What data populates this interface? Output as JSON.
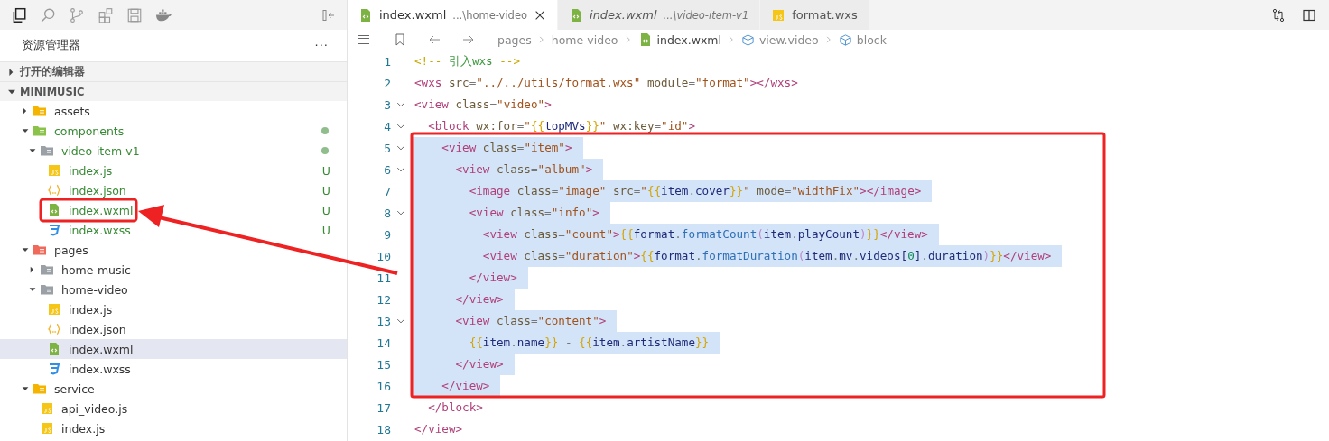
{
  "explorer": {
    "title": "资源管理器",
    "more": "···"
  },
  "sections": [
    {
      "label": "打开的编辑器",
      "expanded": false
    },
    {
      "label": "MINIMUSIC",
      "expanded": true
    }
  ],
  "tree": [
    {
      "label": "assets",
      "kind": "folder",
      "color": "#f4b400",
      "expanded": false,
      "untracked": false,
      "dot": false,
      "selected": false
    },
    {
      "label": "components",
      "kind": "folder",
      "color": "#8bc34a",
      "expanded": true,
      "untracked": true,
      "dot": true,
      "selected": false,
      "children": [
        {
          "label": "video-item-v1",
          "kind": "folder",
          "color": "#9aa0a6",
          "expanded": true,
          "untracked": true,
          "dot": true,
          "selected": false,
          "children": [
            {
              "label": "index.js",
              "kind": "js",
              "untracked": true,
              "dot": false,
              "badge": "U",
              "selected": false
            },
            {
              "label": "index.json",
              "kind": "json",
              "untracked": true,
              "dot": false,
              "badge": "U",
              "selected": false
            },
            {
              "label": "index.wxml",
              "kind": "wxml",
              "untracked": true,
              "dot": false,
              "badge": "U",
              "selected": false
            },
            {
              "label": "index.wxss",
              "kind": "wxss",
              "untracked": true,
              "dot": false,
              "badge": "U",
              "selected": false
            }
          ]
        }
      ]
    },
    {
      "label": "pages",
      "kind": "folder",
      "color": "#ef6a5a",
      "expanded": true,
      "untracked": false,
      "dot": false,
      "selected": false,
      "children": [
        {
          "label": "home-music",
          "kind": "folder",
          "color": "#9aa0a6",
          "expanded": false,
          "untracked": false,
          "dot": false,
          "selected": false
        },
        {
          "label": "home-video",
          "kind": "folder",
          "color": "#9aa0a6",
          "expanded": true,
          "untracked": false,
          "dot": false,
          "selected": false,
          "children": [
            {
              "label": "index.js",
              "kind": "js",
              "untracked": false,
              "dot": false,
              "selected": false
            },
            {
              "label": "index.json",
              "kind": "json",
              "untracked": false,
              "dot": false,
              "selected": false
            },
            {
              "label": "index.wxml",
              "kind": "wxml",
              "untracked": false,
              "dot": false,
              "selected": true
            },
            {
              "label": "index.wxss",
              "kind": "wxss",
              "untracked": false,
              "dot": false,
              "selected": false
            }
          ]
        }
      ]
    },
    {
      "label": "service",
      "kind": "folder",
      "color": "#f4b400",
      "expanded": true,
      "untracked": false,
      "dot": false,
      "selected": false,
      "children": [
        {
          "label": "api_video.js",
          "kind": "js",
          "untracked": false,
          "dot": false,
          "selected": false
        },
        {
          "label": "index.js",
          "kind": "js",
          "untracked": false,
          "dot": false,
          "selected": false
        }
      ]
    }
  ],
  "tabs": [
    {
      "label": "index.wxml",
      "path": "...\\home-video",
      "kind": "wxml",
      "selected": true,
      "preview": false
    },
    {
      "label": "index.wxml",
      "path": "...\\video-item-v1",
      "kind": "wxml",
      "selected": false,
      "preview": true
    },
    {
      "label": "format.wxs",
      "kind": "js",
      "selected": false,
      "preview": false
    }
  ],
  "breadcrumb": [
    {
      "label": "pages",
      "kind": "folder"
    },
    {
      "label": "home-video",
      "kind": "folder"
    },
    {
      "label": "index.wxml",
      "kind": "file"
    },
    {
      "label": "view.video",
      "kind": "symbol"
    },
    {
      "label": "block",
      "kind": "symbol"
    }
  ],
  "code": [
    {
      "number": "1",
      "text": "<!-- 引入wxs -->",
      "foldable": false,
      "selected": false
    },
    {
      "number": "2",
      "text": "<wxs src=\"../../utils/format.wxs\" module=\"format\"></wxs>",
      "foldable": false,
      "selected": false
    },
    {
      "number": "3",
      "text": "<view class=\"video\">",
      "foldable": true,
      "selected": false
    },
    {
      "number": "4",
      "text": "  <block wx:for=\"{{topMVs}}\" wx:key=\"id\">",
      "foldable": true,
      "selected": false
    },
    {
      "number": "5",
      "text": "    <view class=\"item\">",
      "foldable": true,
      "selected": true
    },
    {
      "number": "6",
      "text": "      <view class=\"album\">",
      "foldable": true,
      "selected": true
    },
    {
      "number": "7",
      "text": "        <image class=\"image\" src=\"{{item.cover}}\" mode=\"widthFix\"></image>",
      "foldable": false,
      "selected": true
    },
    {
      "number": "8",
      "text": "        <view class=\"info\">",
      "foldable": true,
      "selected": true
    },
    {
      "number": "9",
      "text": "          <view class=\"count\">{{format.formatCount(item.playCount)}}</view>",
      "foldable": false,
      "selected": true
    },
    {
      "number": "10",
      "text": "          <view class=\"duration\">{{format.formatDuration(item.mv.videos[0].duration)}}</view>",
      "foldable": false,
      "selected": true
    },
    {
      "number": "11",
      "text": "        </view>",
      "foldable": false,
      "selected": true
    },
    {
      "number": "12",
      "text": "      </view>",
      "foldable": false,
      "selected": true
    },
    {
      "number": "13",
      "text": "      <view class=\"content\">",
      "foldable": true,
      "selected": true
    },
    {
      "number": "14",
      "text": "        {{item.name}} - {{item.artistName}}",
      "foldable": false,
      "selected": true
    },
    {
      "number": "15",
      "text": "      </view>",
      "foldable": false,
      "selected": true
    },
    {
      "number": "16",
      "text": "    </view>",
      "foldable": false,
      "selected": true
    },
    {
      "number": "17",
      "text": "  </block>",
      "foldable": false,
      "selected": false
    },
    {
      "number": "18",
      "text": "</view>",
      "foldable": false,
      "selected": false
    }
  ]
}
